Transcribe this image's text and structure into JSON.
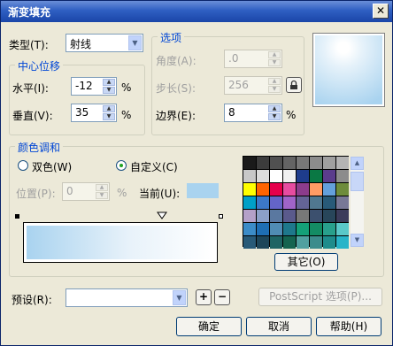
{
  "window": {
    "title": "渐变填充",
    "close_glyph": "✕"
  },
  "type": {
    "label": "类型(T):",
    "value": "射线"
  },
  "center_offset": {
    "title": "中心位移",
    "horizontal": {
      "label": "水平(I):",
      "value": "-12",
      "unit": "%"
    },
    "vertical": {
      "label": "垂直(V):",
      "value": "35",
      "unit": "%"
    }
  },
  "options": {
    "title": "选项",
    "angle": {
      "label": "角度(A):",
      "value": ".0"
    },
    "steps": {
      "label": "步长(S):",
      "value": "256"
    },
    "edge": {
      "label": "边界(E):",
      "value": "8",
      "unit": "%"
    }
  },
  "color_blend": {
    "title": "颜色调和",
    "two_color": {
      "label": "双色(W)",
      "checked": false
    },
    "custom": {
      "label": "自定义(C)",
      "checked": true
    },
    "position": {
      "label": "位置(P):",
      "value": "0",
      "unit": "%"
    },
    "current": {
      "label": "当前(U):",
      "color": "#a9d3ef"
    },
    "gradient_colors": [
      "#a9d3ef",
      "#e8f2fa",
      "#ffffff"
    ],
    "other_button": "其它(O)",
    "palette": [
      "#1a1a1a",
      "#3c3c3c",
      "#505050",
      "#646464",
      "#787878",
      "#8c8c8c",
      "#a0a0a0",
      "#b4b4b4",
      "#c8c8c8",
      "#dcdcdc",
      "#ffffff",
      "#f0f0f0",
      "#1e3c8c",
      "#0a7844",
      "#5a3c8c",
      "#8c8c8c",
      "#ffff00",
      "#ff6400",
      "#e6004c",
      "#e64ca0",
      "#8c3c8c",
      "#ff9c64",
      "#64a0dc",
      "#6e8c3c",
      "#00a0c8",
      "#3c78c8",
      "#6464c8",
      "#a064c8",
      "#646496",
      "#507890",
      "#285a78",
      "#787896",
      "#b4a0c8",
      "#8ca0c8",
      "#5a78a0",
      "#5a5a8c",
      "#787878",
      "#3c506e",
      "#28465a",
      "#3c3c5a",
      "#3c8cc8",
      "#1e6eb4",
      "#508cb4",
      "#1e788c",
      "#14a078",
      "#148c64",
      "#28a08c",
      "#5ac8c8",
      "#285a78",
      "#1e465a",
      "#1e6464",
      "#146450",
      "#50a0a0",
      "#3c8c8c",
      "#1e8c8c",
      "#28b4c8"
    ]
  },
  "preset": {
    "label": "预设(R):",
    "value": "",
    "add_glyph": "+",
    "remove_glyph": "−"
  },
  "buttons": {
    "postscript": "PostScript 选项(P)...",
    "ok": "确定",
    "cancel": "取消",
    "help": "帮助(H)"
  }
}
